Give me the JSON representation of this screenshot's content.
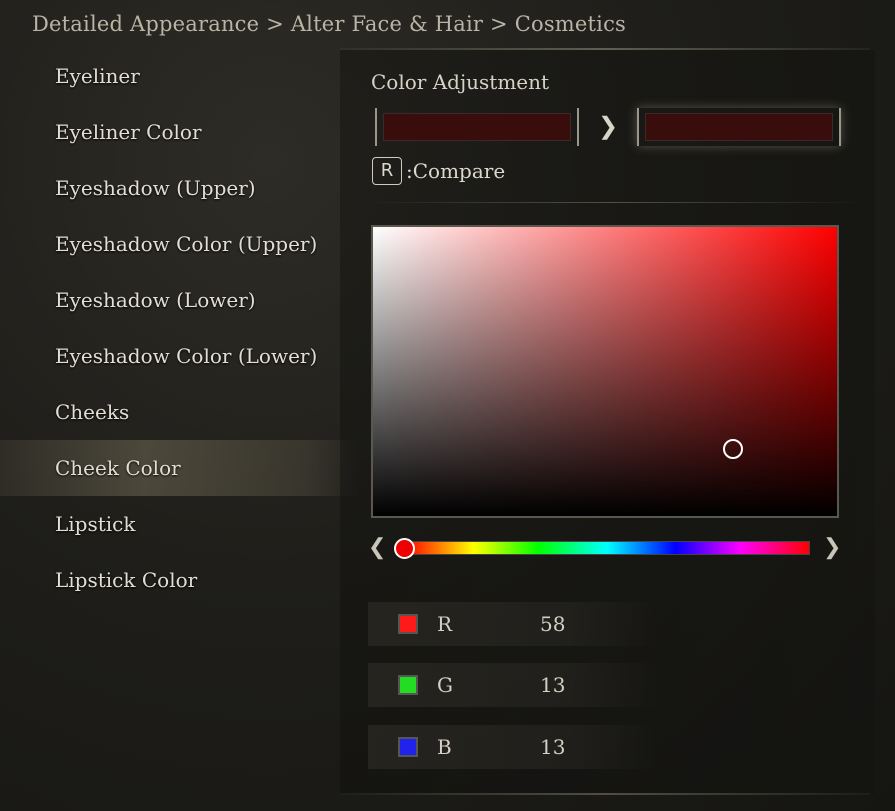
{
  "breadcrumb": "Detailed Appearance > Alter Face & Hair > Cosmetics",
  "menu": [
    {
      "label": "Eyeliner"
    },
    {
      "label": "Eyeliner Color"
    },
    {
      "label": "Eyeshadow (Upper)"
    },
    {
      "label": "Eyeshadow Color (Upper)"
    },
    {
      "label": "Eyeshadow (Lower)"
    },
    {
      "label": "Eyeshadow Color (Lower)"
    },
    {
      "label": "Cheeks"
    },
    {
      "label": "Cheek Color",
      "selected": true
    },
    {
      "label": "Lipstick"
    },
    {
      "label": "Lipstick Color"
    }
  ],
  "color_adjustment": {
    "title": "Color Adjustment",
    "old_color": "#3a0d0d",
    "new_color": "#3a0d0d",
    "compare_key": "R",
    "compare_label": ":Compare",
    "picker_base": "#ff0000",
    "cursor_icon": "circle-cursor-icon",
    "hue_prev_icon": "chevron-left-icon",
    "hue_next_icon": "chevron-right-icon"
  },
  "channels": [
    {
      "label": "R",
      "value": "58",
      "color": "#ff1a1a"
    },
    {
      "label": "G",
      "value": "13",
      "color": "#22dd22"
    },
    {
      "label": "B",
      "value": "13",
      "color": "#2222ee"
    }
  ]
}
